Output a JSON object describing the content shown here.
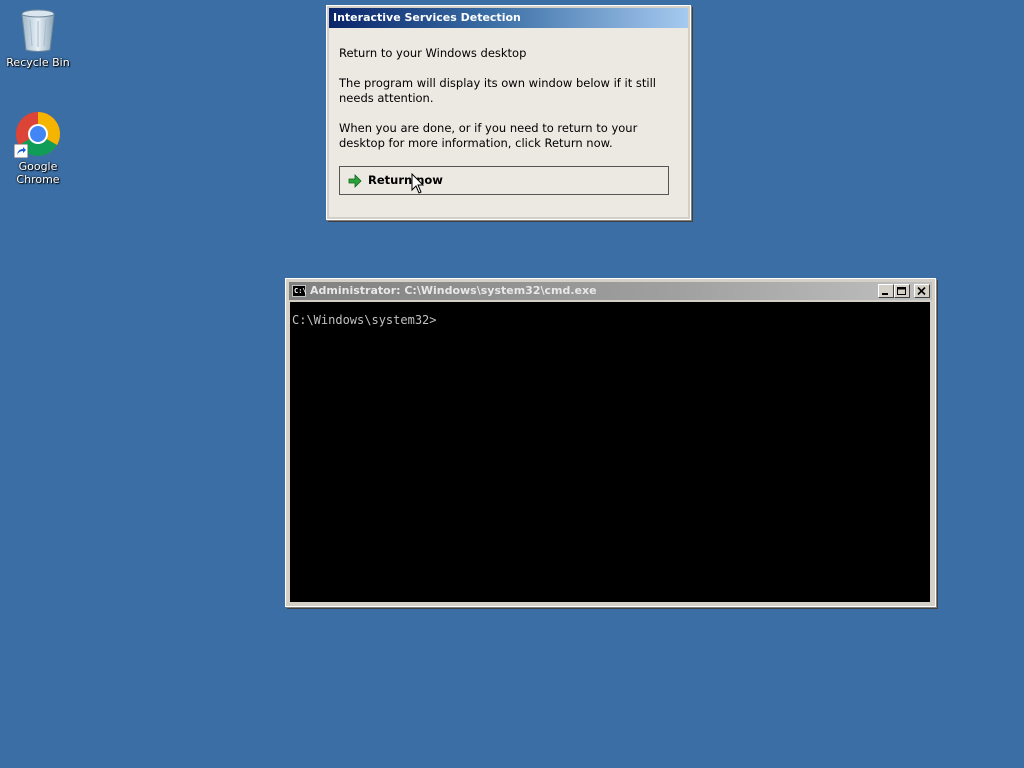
{
  "desktop": {
    "icons": [
      {
        "label": "Recycle Bin",
        "icon": "recycle-bin-icon"
      },
      {
        "label": "Google Chrome",
        "icon": "chrome-icon"
      }
    ]
  },
  "isd_dialog": {
    "title": "Interactive Services Detection",
    "heading": "Return to your Windows desktop",
    "paragraph1": "The program will display its own window below if it still needs attention.",
    "paragraph2": "When you are done, or if you need to return to your desktop for more information, click Return now.",
    "return_button_label": "Return now"
  },
  "cmd_window": {
    "title": "Administrator: C:\\Windows\\system32\\cmd.exe",
    "prompt": "C:\\Windows\\system32>"
  },
  "colors": {
    "desktop_background": "#3a6ea5",
    "dialog_title_active": "#0a246a",
    "console_background": "#000000",
    "console_text": "#c0c0c0"
  }
}
